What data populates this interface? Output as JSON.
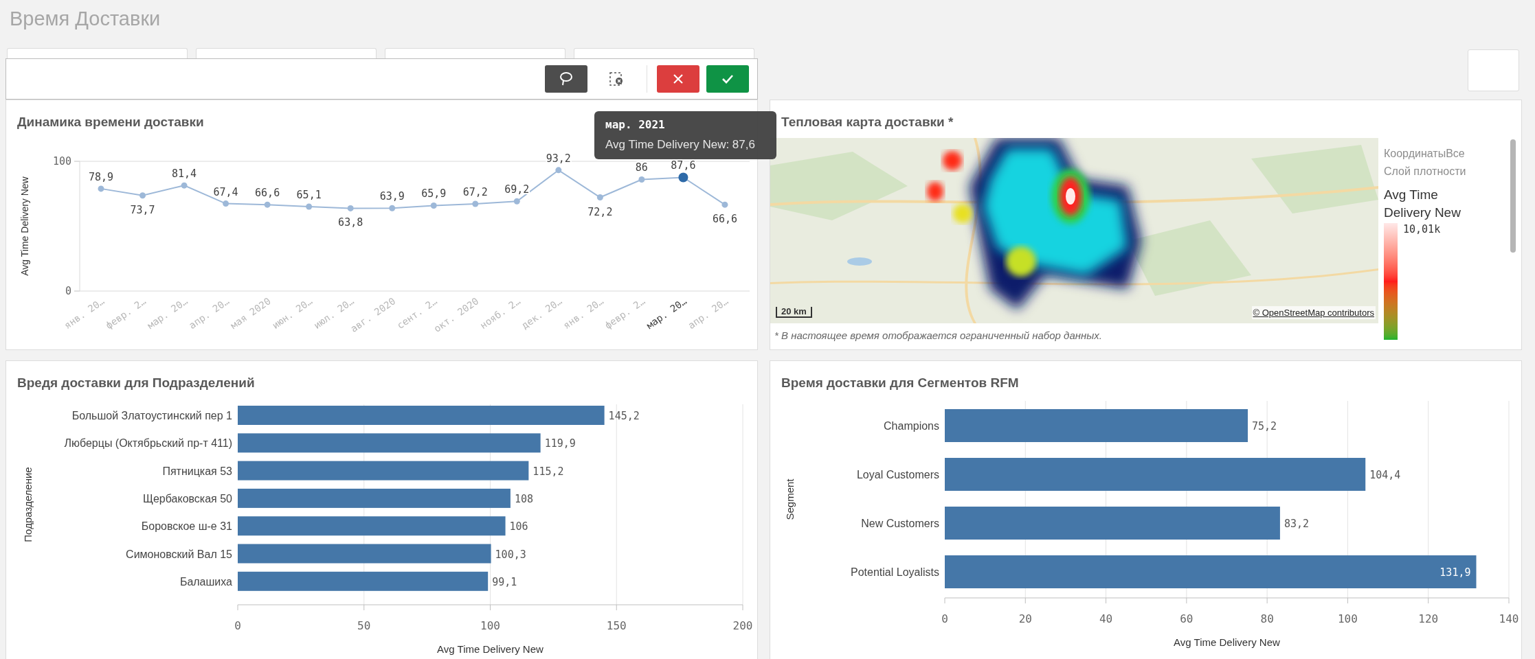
{
  "app_title": "Время Доставки",
  "selection_toolbar": {
    "buttons": [
      {
        "kind": "lasso"
      },
      {
        "kind": "clear"
      },
      {
        "kind": "cancel"
      },
      {
        "kind": "confirm"
      }
    ]
  },
  "line_chart": {
    "title": "Динамика времени доставки",
    "chart_data": {
      "type": "line",
      "ylabel": "Avg Time Delivery New",
      "categories": [
        "янв. 20…",
        "февр. 2…",
        "мар. 20…",
        "апр. 20…",
        "мая 2020",
        "июн. 20…",
        "июл. 20…",
        "авг. 2020",
        "сент. 2…",
        "окт. 2020",
        "нояб. 2…",
        "дек. 20…",
        "янв. 20…",
        "февр. 2…",
        "мар. 20…",
        "апр. 20…"
      ],
      "series": [
        {
          "color": "#9db8d8",
          "marker": "circle",
          "values": [
            78.9,
            73.7,
            81.4,
            67.4,
            66.6,
            65.1,
            63.8,
            63.9,
            65.9,
            67.2,
            69.2,
            93.2,
            72.2,
            86,
            87.6,
            66.6
          ]
        }
      ],
      "value_labels": [
        "78,9",
        "73,7",
        "81,4",
        "67,4",
        "66,6",
        "65,1",
        "63,8",
        "63,9",
        "65,9",
        "67,2",
        "69,2",
        "93,2",
        "72,2",
        "86",
        "87,6",
        "66,6"
      ],
      "ylim": [
        0,
        100
      ],
      "yticks": [
        0,
        100
      ]
    },
    "points": [
      {
        "selected": false
      },
      {
        "selected": false
      },
      {
        "selected": false
      },
      {
        "selected": false
      },
      {
        "selected": false
      },
      {
        "selected": false
      },
      {
        "selected": false
      },
      {
        "selected": false
      },
      {
        "selected": false
      },
      {
        "selected": false
      },
      {
        "selected": false
      },
      {
        "selected": false
      },
      {
        "selected": false
      },
      {
        "selected": false
      },
      {
        "selected": true
      },
      {
        "selected": false
      }
    ]
  },
  "tooltip": {
    "title": "мар. 2021",
    "text": "Avg Time Delivery New: 87,6"
  },
  "heatmap": {
    "title": "Тепловая карта доставки *",
    "scale": "20 km",
    "attribution": "© OpenStreetMap contributors",
    "legend": {
      "lines": [
        "КоординатыВсе",
        "Слой плотности"
      ],
      "measure": "Avg Time Delivery New",
      "max_label": "10,01k"
    },
    "footnote": "* В настоящее время отображается ограниченный набор данных."
  },
  "units_chart": {
    "title": "Вредя доставки для Подразделений",
    "chart_data": {
      "type": "bar",
      "orientation": "horizontal",
      "xlabel": "Avg Time Delivery New",
      "ylabel": "Подразделение",
      "categories": [
        "Большой Златоустинский пер 1",
        "Люберцы (Октябрьский пр-т 411)",
        "Пятницкая 53",
        "Щербаковская 50",
        "Боровское ш-е 31",
        "Симоновский Вал 15",
        "Балашиха"
      ],
      "series": [
        {
          "color": "#4577a8",
          "values": [
            145.2,
            119.9,
            115.2,
            108,
            106,
            100.3,
            99.1
          ]
        }
      ],
      "value_labels": [
        "145,2",
        "119,9",
        "115,2",
        "108",
        "106",
        "100,3",
        "99,1"
      ],
      "grid": true,
      "xlim": [
        0,
        200
      ],
      "xticks": [
        0,
        50,
        100,
        150,
        200
      ]
    }
  },
  "segments_chart": {
    "title": "Время доставки для Сегментов RFM",
    "chart_data": {
      "type": "bar",
      "orientation": "horizontal",
      "xlabel": "Avg Time Delivery New",
      "ylabel": "Segment",
      "categories": [
        "Champions",
        "Loyal Customers",
        "New Customers",
        "Potential Loyalists"
      ],
      "series": [
        {
          "color": "#4577a8",
          "values": [
            75.2,
            104.4,
            83.2,
            131.9
          ]
        }
      ],
      "value_labels": [
        "75,2",
        "104,4",
        "83,2",
        "131,9"
      ],
      "grid": true,
      "xlim": [
        0,
        140
      ],
      "xticks": [
        0,
        20,
        40,
        60,
        80,
        100,
        120,
        140
      ]
    }
  }
}
